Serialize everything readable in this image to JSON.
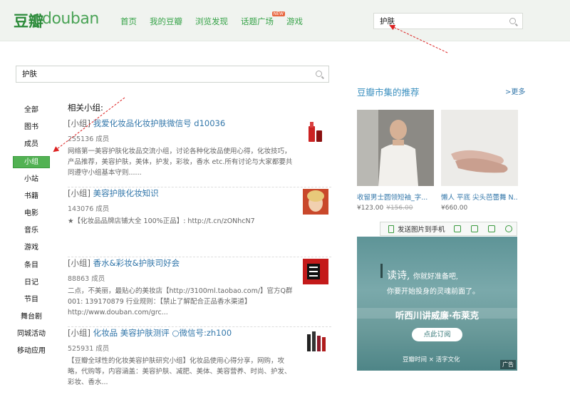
{
  "header": {
    "logo_cn": "豆瓣",
    "logo_en": "douban",
    "nav": [
      "首页",
      "我的豆瓣",
      "浏览发现",
      "话题广场",
      "游戏"
    ],
    "nav_new_badge": "NEW",
    "search_value": "护肤"
  },
  "main_search": {
    "value": "护肤"
  },
  "categories": [
    "全部",
    "图书",
    "成员",
    "小组",
    "小站",
    "书籍",
    "电影",
    "音乐",
    "游戏",
    "条目",
    "日记",
    "节目",
    "舞台剧",
    "同城活动",
    "移动应用"
  ],
  "active_category_index": 3,
  "results": {
    "title": "相关小组:",
    "items": [
      {
        "tag": "[小组]",
        "name": "我爱化妆品化妆护肤微信号 d10036",
        "members": "255136 成员",
        "desc": "网络第一美容护肤化妆品交流小组，讨论各种化妆品使用心得，化妆技巧，产品推荐，美容护肤，美体，护发，彩妆，香水 etc.所有讨论与大家都要共同遵守小组基本守则......"
      },
      {
        "tag": "[小组]",
        "name": "美容护肤化妆知识",
        "members": "143076 成员",
        "desc": "★【化妆品品牌店铺大全 100%正品】: http://t.cn/zONhcN7"
      },
      {
        "tag": "[小组]",
        "name": "香水&彩妆&护肤司好会",
        "members": "88863 成员",
        "desc": "二点，不美丽，最贴心的美妆店【http://3100ml.taobao.com/】官方Q群001: 139170879 行业规则：【禁止了解配合正品香水渠道】 http://www.douban.com/grc..."
      },
      {
        "tag": "[小组]",
        "name": "化妆品 美容护肤测评 ○微信号:zh100",
        "members": "525931 成员",
        "desc": "【豆瓣全球性的化妆美容护肤研究小组】化妆品使用心得分享，网购，攻略，代购等，内容涵盖：美容护肤、减肥、美体、美容营养、时尚、护发、彩妆、香水..."
      }
    ]
  },
  "market": {
    "title": "豆瓣市集的推荐",
    "more": ">更多",
    "products": [
      {
        "name": "收留男士圆领短袖_字...",
        "price": "¥123.00",
        "old_price": "¥156.00"
      },
      {
        "name": "懒人 平底 尖头芭蕾舞 N...",
        "price": "¥660.00",
        "old_price": ""
      }
    ]
  },
  "ad_toolbar": {
    "send_label": "发送图片到手机"
  },
  "ad": {
    "poem_line1": "读诗,",
    "poem_line1b": "你就好准备吧,",
    "poem_line2": "你要开始投身的灵魂前面了。",
    "headline": "听西川讲威廉·布莱克",
    "cta": "点此订阅",
    "brand": "豆瓣时间 × 活字文化",
    "ad_label": "广告"
  },
  "colors": {
    "brand_green": "#37a349",
    "link_blue": "#3377aa",
    "active_green": "#52b253"
  }
}
